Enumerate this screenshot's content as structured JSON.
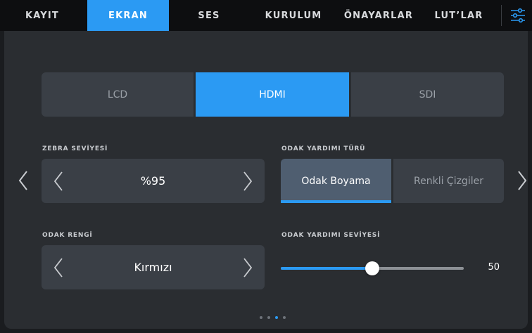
{
  "tabs": [
    {
      "label": "KAYIT",
      "active": false
    },
    {
      "label": "EKRAN",
      "active": true
    },
    {
      "label": "SES",
      "active": false
    },
    {
      "label": "KURULUM",
      "active": false
    },
    {
      "label": "ÖNAYARLAR",
      "active": false
    },
    {
      "label": "LUT’LAR",
      "active": false
    }
  ],
  "menu_icon": "sliders-icon",
  "display_selector": {
    "options": [
      "LCD",
      "HDMI",
      "SDI"
    ],
    "selected": "HDMI"
  },
  "zebra": {
    "label": "ZEBRA SEVİYESİ",
    "value": "%95"
  },
  "focus_assist_type": {
    "label": "ODAK YARDIMI TÜRÜ",
    "options": [
      "Odak Boyama",
      "Renkli Çizgiler"
    ],
    "selected": "Odak Boyama"
  },
  "focus_color": {
    "label": "ODAK RENGİ",
    "value": "Kırmızı"
  },
  "focus_assist_level": {
    "label": "ODAK YARDIMI SEVİYESİ",
    "value": "50",
    "fraction": 0.5
  },
  "pagination": {
    "count": 4,
    "current": 3
  },
  "colors": {
    "accent": "#2b9af3",
    "panel": "#2a2d31",
    "control": "#3a3f46",
    "tabbar": "#0d0e10"
  }
}
